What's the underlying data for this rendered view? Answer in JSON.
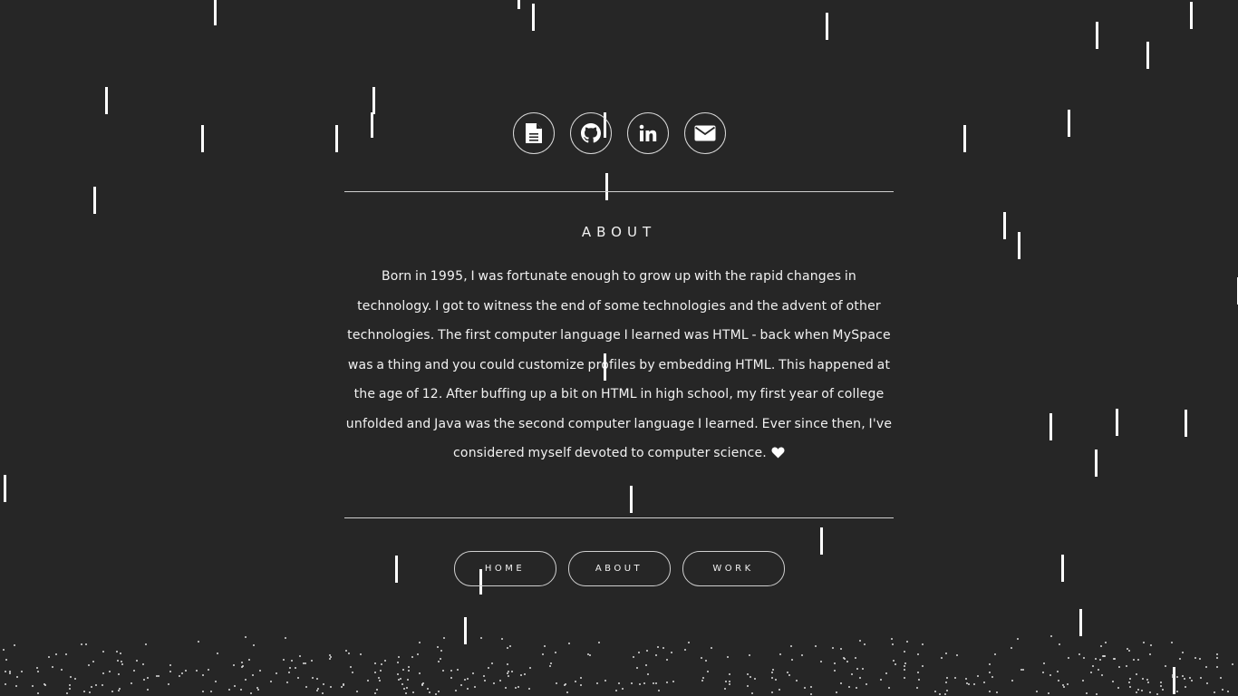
{
  "social": [
    {
      "name": "resume",
      "icon": "document-icon"
    },
    {
      "name": "github",
      "icon": "github-icon"
    },
    {
      "name": "linkedin",
      "icon": "linkedin-icon"
    },
    {
      "name": "email",
      "icon": "envelope-icon"
    }
  ],
  "about": {
    "heading": "ABOUT",
    "text": "Born in 1995, I was fortunate enough to grow up with the rapid changes in technology. I got to witness the end of some technologies and the advent of other technologies. The first computer language I learned was HTML - back when MySpace was a thing and you could customize profiles by embedding HTML. This happened at the age of 12. After buffing up a bit on HTML in high school, my first year of college unfolded and Java was the second computer language I learned. Ever since then, I've considered myself devoted to computer science.",
    "end_icon": "heart-icon"
  },
  "nav": {
    "home": "HOME",
    "about": "ABOUT",
    "work": "WORK"
  },
  "colors": {
    "background": "#262626",
    "foreground": "#ffffff",
    "border": "#cfcfcf"
  }
}
